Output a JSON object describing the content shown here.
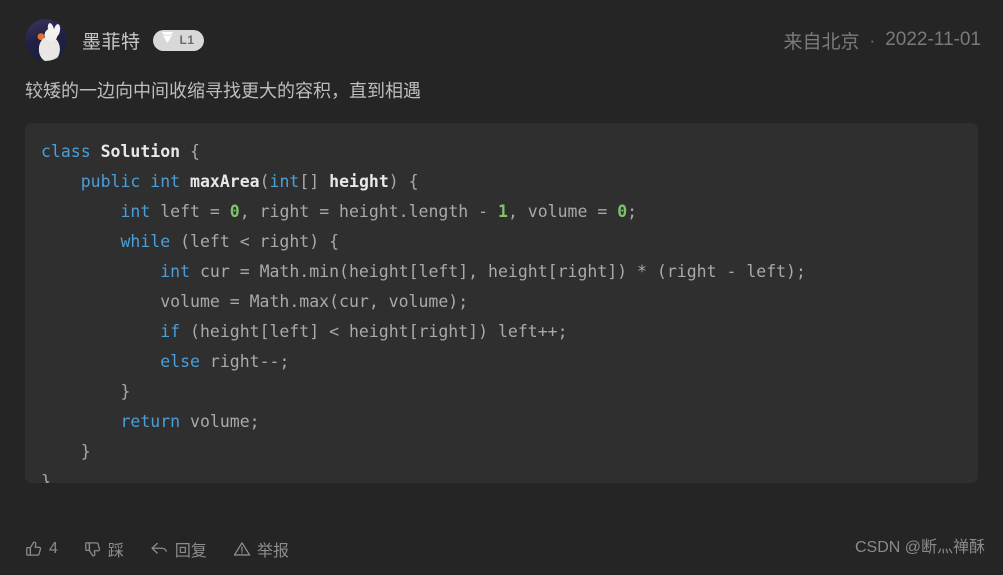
{
  "colors": {
    "page_bg": "#252526",
    "code_bg": "#2f2f2f",
    "keyword": "#4a9fd8",
    "identifier": "#e8e8e8",
    "number": "#7fc36a",
    "plain_code": "#a9a9a9",
    "muted_text": "#7a7a7a",
    "badge_bg": "#d8d8d8"
  },
  "header": {
    "avatar_icon": "rabbit-avatar",
    "username": "墨菲特",
    "badge": {
      "icon": "gem-diamond-icon",
      "level": "L1"
    },
    "location": "来自北京",
    "separator": "·",
    "date": "2022-11-01"
  },
  "comment": {
    "text": "较矮的一边向中间收缩寻找更大的容积，直到相遇"
  },
  "code": {
    "language": "java",
    "lines": [
      [
        {
          "t": "class",
          "c": "kw"
        },
        {
          "t": " ",
          "c": "pln"
        },
        {
          "t": "Solution",
          "c": "name"
        },
        {
          "t": " {",
          "c": "pln"
        }
      ],
      [
        {
          "t": "    ",
          "c": "pln"
        },
        {
          "t": "public",
          "c": "kw"
        },
        {
          "t": " ",
          "c": "pln"
        },
        {
          "t": "int",
          "c": "kw"
        },
        {
          "t": " ",
          "c": "pln"
        },
        {
          "t": "maxArea",
          "c": "name"
        },
        {
          "t": "(",
          "c": "pln"
        },
        {
          "t": "int",
          "c": "kw"
        },
        {
          "t": "[] ",
          "c": "pln"
        },
        {
          "t": "height",
          "c": "name"
        },
        {
          "t": ") {",
          "c": "pln"
        }
      ],
      [
        {
          "t": "        ",
          "c": "pln"
        },
        {
          "t": "int",
          "c": "kw"
        },
        {
          "t": " left = ",
          "c": "pln"
        },
        {
          "t": "0",
          "c": "num"
        },
        {
          "t": ", right = height.length - ",
          "c": "pln"
        },
        {
          "t": "1",
          "c": "num"
        },
        {
          "t": ", volume = ",
          "c": "pln"
        },
        {
          "t": "0",
          "c": "num"
        },
        {
          "t": ";",
          "c": "pln"
        }
      ],
      [
        {
          "t": "        ",
          "c": "pln"
        },
        {
          "t": "while",
          "c": "kw"
        },
        {
          "t": " (left < right) {",
          "c": "pln"
        }
      ],
      [
        {
          "t": "            ",
          "c": "pln"
        },
        {
          "t": "int",
          "c": "kw"
        },
        {
          "t": " cur = Math.min(height[left], height[right]) * (right - left);",
          "c": "pln"
        }
      ],
      [
        {
          "t": "            volume = Math.max(cur, volume);",
          "c": "pln"
        }
      ],
      [
        {
          "t": "            ",
          "c": "pln"
        },
        {
          "t": "if",
          "c": "kw"
        },
        {
          "t": " (height[left] < height[right]) left++;",
          "c": "pln"
        }
      ],
      [
        {
          "t": "            ",
          "c": "pln"
        },
        {
          "t": "else",
          "c": "kw"
        },
        {
          "t": " right--;",
          "c": "pln"
        }
      ],
      [
        {
          "t": "        }",
          "c": "pln"
        }
      ],
      [
        {
          "t": "        ",
          "c": "pln"
        },
        {
          "t": "return",
          "c": "kw"
        },
        {
          "t": " volume;",
          "c": "pln"
        }
      ],
      [
        {
          "t": "    }",
          "c": "pln"
        }
      ],
      [
        {
          "t": "}",
          "c": "pln"
        }
      ]
    ]
  },
  "actions": [
    {
      "icon": "thumbs-up-icon",
      "label": "4"
    },
    {
      "icon": "thumbs-down-icon",
      "label": "踩"
    },
    {
      "icon": "reply-arrow-icon",
      "label": "回复"
    },
    {
      "icon": "warning-triangle-icon",
      "label": "举报"
    }
  ],
  "watermark": {
    "text": "CSDN @断灬禅酥"
  }
}
